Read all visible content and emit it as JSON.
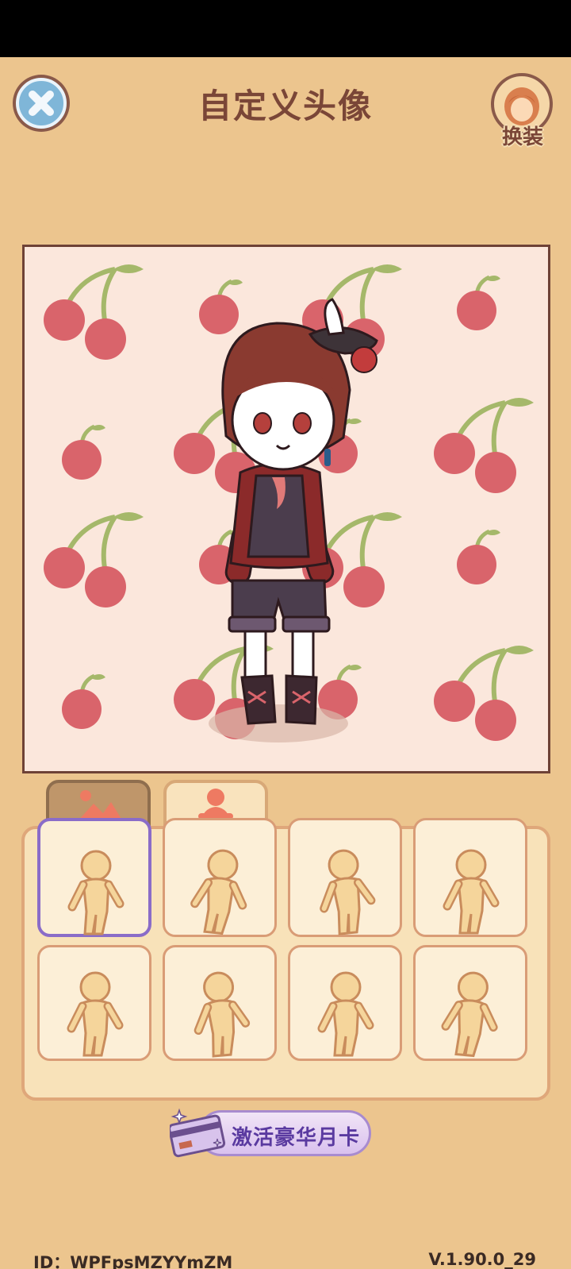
{
  "header": {
    "title": "自定义头像",
    "outfit_label": "换装"
  },
  "tabs": [
    {
      "name": "background",
      "icon": "landscape-icon",
      "selected": true
    },
    {
      "name": "pose",
      "icon": "person-icon",
      "selected": false
    }
  ],
  "poses": {
    "count": 8,
    "selected_index": 0
  },
  "vip": {
    "label": "激活豪华月卡"
  },
  "footer": {
    "id_text": "ID：WPFpsMZYYmZM",
    "version": "V.1.90.0_29"
  },
  "colors": {
    "background": "#ecc58e",
    "accent_purple": "#8a6cc8",
    "cherry": "#d9646b"
  }
}
